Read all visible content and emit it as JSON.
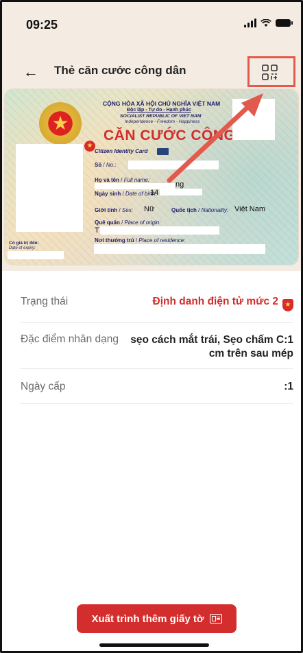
{
  "status": {
    "time": "09:25"
  },
  "header": {
    "back_icon": "arrow-left-icon",
    "title": "Thẻ căn cước công dân",
    "qr_icon": "qr-code-icon"
  },
  "card": {
    "nation": "CỘNG HÒA XÃ HỘI CHỦ NGHĨA VIỆT NAM",
    "motto": "Độc lập - Tự do - Hạnh phúc",
    "nation_en": "SOCIALIST REPUBLIC OF VIET NAM",
    "motto_en": "Independence - Freedom - Happiness",
    "title": "CĂN CƯỚC CÔNG DÂN",
    "title_en": "Citizen Identity Card",
    "no_label": "Số",
    "no_label_en": "No.:",
    "name_label": "Họ và tên",
    "name_label_en": "Full name:",
    "name_value_fragment": "ng",
    "dob_label": "Ngày sinh",
    "dob_label_en": "Date of birth:",
    "dob_value_fragment": "14",
    "sex_label": "Giới tính",
    "sex_label_en": "Sex:",
    "sex_value": "Nữ",
    "nationality_label": "Quốc tịch",
    "nationality_label_en": "Nationality:",
    "nationality_value": "Việt Nam",
    "origin_label": "Quê quán",
    "origin_label_en": "Place of origin:",
    "origin_value_fragment": "T",
    "residence_label": "Nơi thường trú",
    "residence_label_en": "Place of residence:",
    "expiry_label": "Có giá trị đến:",
    "expiry_label_en": "Date of expiry:"
  },
  "info": {
    "status_label": "Trạng thái",
    "status_value": "Định danh điện tử mức 2",
    "features_label": "Đặc điểm nhân dạng",
    "features_value": "sẹo cách mắt trái, Sẹo chấm C:1 cm trên sau mép",
    "issue_date_label": "Ngày cấp",
    "issue_date_value": ":1"
  },
  "cta": {
    "label": "Xuất trình thêm giấy tờ",
    "icon": "document-id-icon"
  },
  "colors": {
    "accent": "#d42d2d",
    "highlight": "#e25a4d",
    "top_bg": "#f4ece2"
  }
}
